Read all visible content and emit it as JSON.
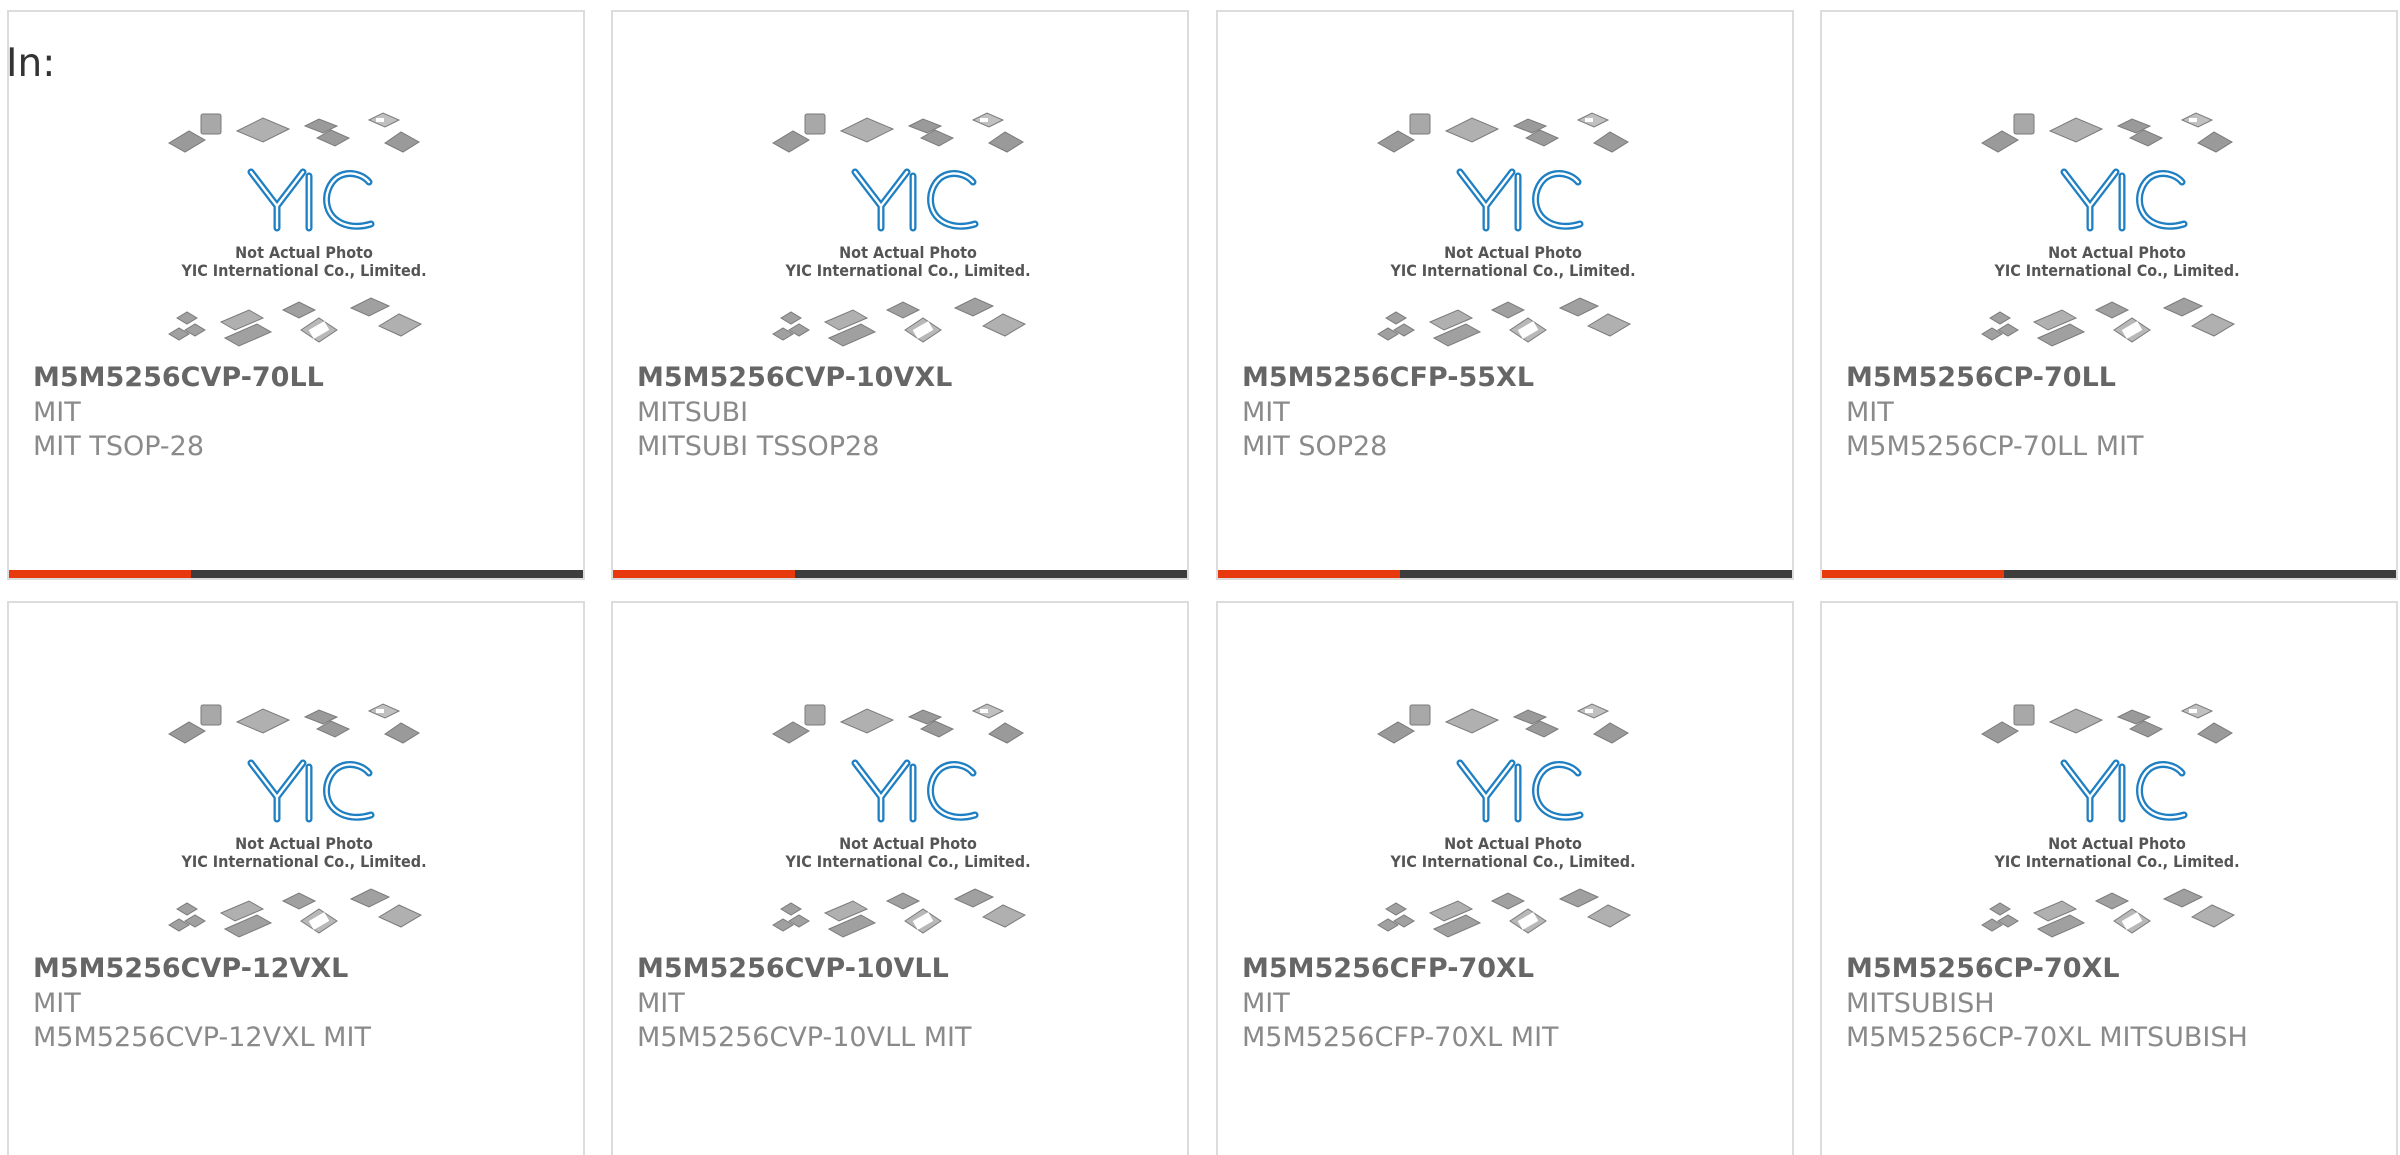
{
  "header": {
    "label": "In:"
  },
  "colors": {
    "accent": "#e8380d",
    "bar": "#3d3d3d",
    "logo": "#1e7fc2"
  },
  "placeholder": {
    "logo_text": "YIC",
    "caption_1": "Not Actual Photo",
    "caption_2": "YIC International Co., Limited."
  },
  "products": [
    {
      "part": "M5M5256CVP-70LL",
      "mfr": "MIT",
      "desc": "MIT TSOP-28"
    },
    {
      "part": "M5M5256CVP-10VXL",
      "mfr": "MITSUBI",
      "desc": "MITSUBI TSSOP28"
    },
    {
      "part": "M5M5256CFP-55XL",
      "mfr": "MIT",
      "desc": "MIT SOP28"
    },
    {
      "part": "M5M5256CP-70LL",
      "mfr": "MIT",
      "desc": "M5M5256CP-70LL MIT"
    },
    {
      "part": "M5M5256CVP-12VXL",
      "mfr": "MIT",
      "desc": "M5M5256CVP-12VXL MIT"
    },
    {
      "part": "M5M5256CVP-10VLL",
      "mfr": "MIT",
      "desc": "M5M5256CVP-10VLL MIT"
    },
    {
      "part": "M5M5256CFP-70XL",
      "mfr": "MIT",
      "desc": "M5M5256CFP-70XL MIT"
    },
    {
      "part": "M5M5256CP-70XL",
      "mfr": "MITSUBISH",
      "desc": "M5M5256CP-70XL MITSUBISH"
    }
  ]
}
